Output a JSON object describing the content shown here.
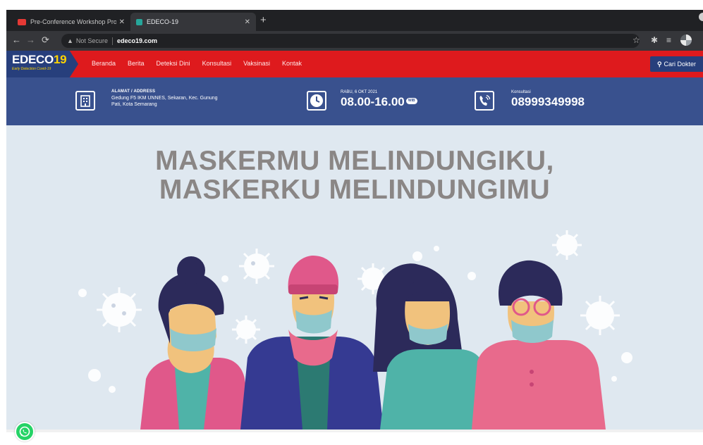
{
  "browser": {
    "tabs": [
      {
        "title": "Pre-Conference Workshop Pro",
        "favicon_color": "#e53935",
        "active": false
      },
      {
        "title": "EDECO-19",
        "favicon_color": "#26a69a",
        "active": true
      }
    ],
    "close_glyph": "✕",
    "new_tab_glyph": "+",
    "security_label": "Not Secure",
    "url": "edeco19.com"
  },
  "site": {
    "logo": {
      "text": "EDECO",
      "number": "19",
      "tagline": "Early Detection Covid-19"
    },
    "menu": [
      "Beranda",
      "Berita",
      "Deteksi Dini",
      "Konsultasi",
      "Vaksinasi",
      "Kontak"
    ],
    "search_button": "Cari Dokter",
    "colors": {
      "nav_red": "#de1a1d",
      "brand_blue": "#273f7c",
      "info_blue": "#39518e",
      "logo_yellow": "#ffd400",
      "whatsapp": "#25d366"
    }
  },
  "info": {
    "address": {
      "label": "ALAMAT / ADDRESS",
      "line1": "Gedung F5 IKM UNNES, Sekaran, Kec. Gunung",
      "line2": "Pati, Kota Semarang",
      "icon": "building-icon"
    },
    "hours": {
      "label": "RABU, 6 OKT 2021",
      "badge": "WIB",
      "value": "08.00-16.00",
      "icon": "clock-icon"
    },
    "phone": {
      "label": "Konsultasi",
      "value": "08999349998",
      "icon": "phone-icon"
    }
  },
  "hero": {
    "line1": "MASKERMU MELINDUNGIKU,",
    "line2": "MASKERKU MELINDUNGIMU"
  }
}
